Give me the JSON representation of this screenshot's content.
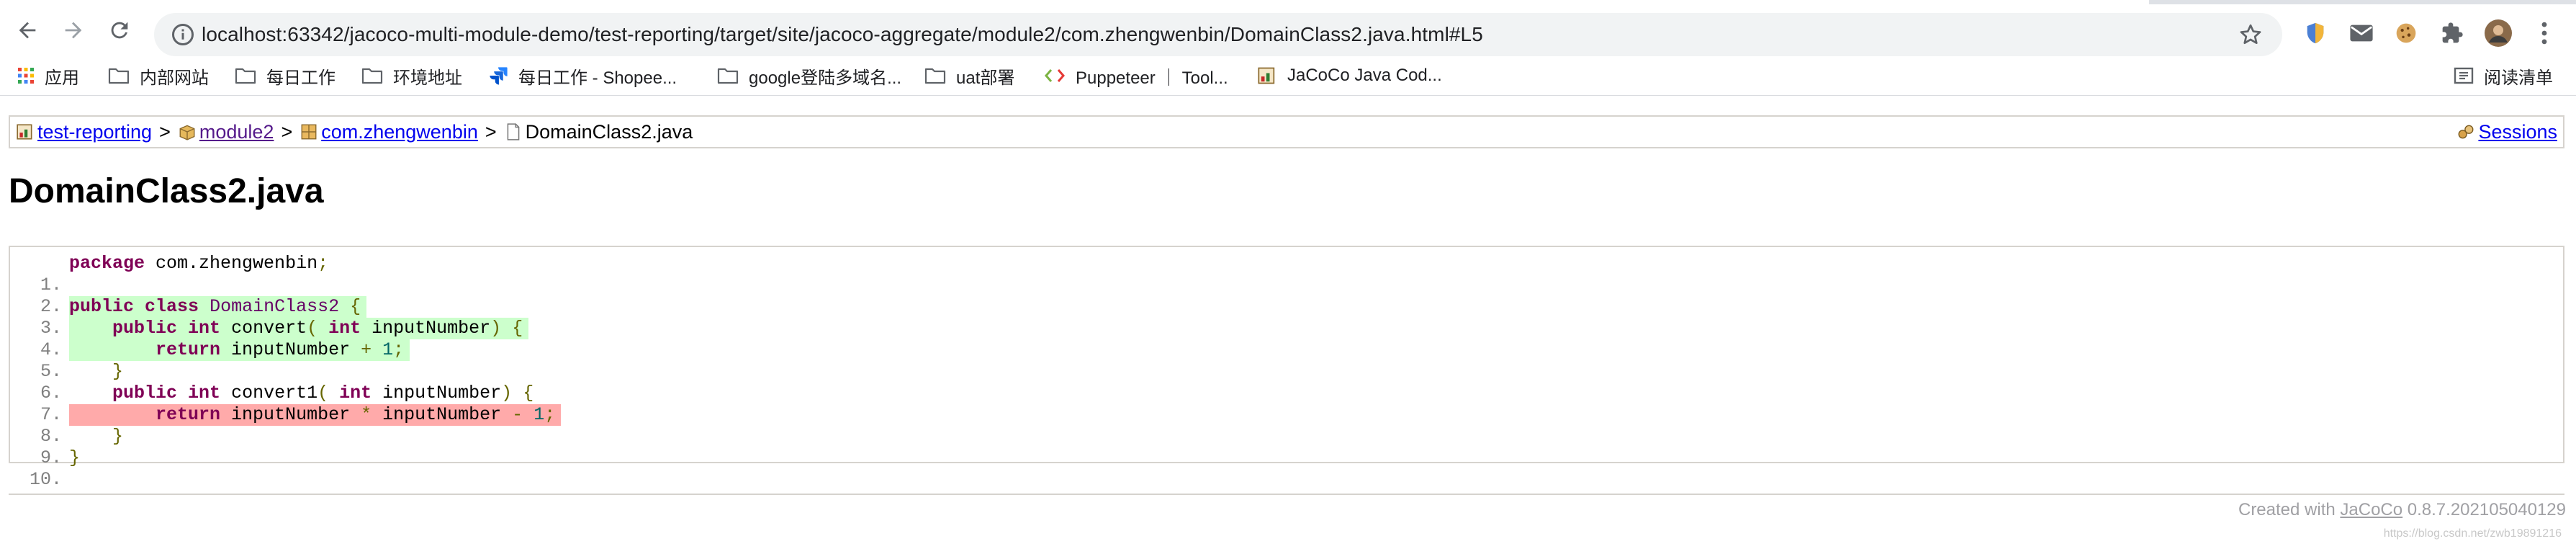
{
  "browser": {
    "url": "localhost:63342/jacoco-multi-module-demo/test-reporting/target/site/jacoco-aggregate/module2/com.zhengwenbin/DomainClass2.java.html#L5",
    "bookmarks": [
      {
        "label": "应用",
        "icon": "apps-grid-icon"
      },
      {
        "label": "内部网站",
        "icon": "folder-icon"
      },
      {
        "label": "每日工作",
        "icon": "folder-icon"
      },
      {
        "label": "环境地址",
        "icon": "folder-icon"
      },
      {
        "label": "每日工作 - Shopee...",
        "icon": "jira-icon"
      },
      {
        "label": "google登陆多域名...",
        "icon": "folder-icon"
      },
      {
        "label": "uat部署",
        "icon": "folder-icon"
      },
      {
        "label": "Puppeteer ｜ Tool...",
        "icon": "puppeteer-icon"
      },
      {
        "label": "JaCoCo Java Cod...",
        "icon": "jacoco-icon"
      }
    ],
    "reading_list": "阅读清单"
  },
  "breadcrumb": {
    "items": [
      "test-reporting",
      "module2",
      "com.zhengwenbin"
    ],
    "current": "DomainClass2.java",
    "separator": ">",
    "sessions": "Sessions"
  },
  "page": {
    "title": "DomainClass2.java"
  },
  "source": {
    "line_numbers": [
      "1.",
      "2.",
      "3.",
      "4.",
      "5.",
      "6.",
      "7.",
      "8.",
      "9.",
      "10."
    ],
    "coverage": [
      "",
      "",
      "fc",
      "fc",
      "fc",
      "",
      "",
      "nc",
      "",
      ""
    ]
  },
  "footer": {
    "prefix": "Created with ",
    "link": "JaCoCo",
    "version": " 0.8.7.202105040129"
  },
  "watermark": "https://blog.csdn.net/zwb19891216",
  "colors": {
    "covered": "#ccffcc",
    "not_covered": "#ffaaaa",
    "link": "#0000ee",
    "visited": "#551a8b"
  }
}
